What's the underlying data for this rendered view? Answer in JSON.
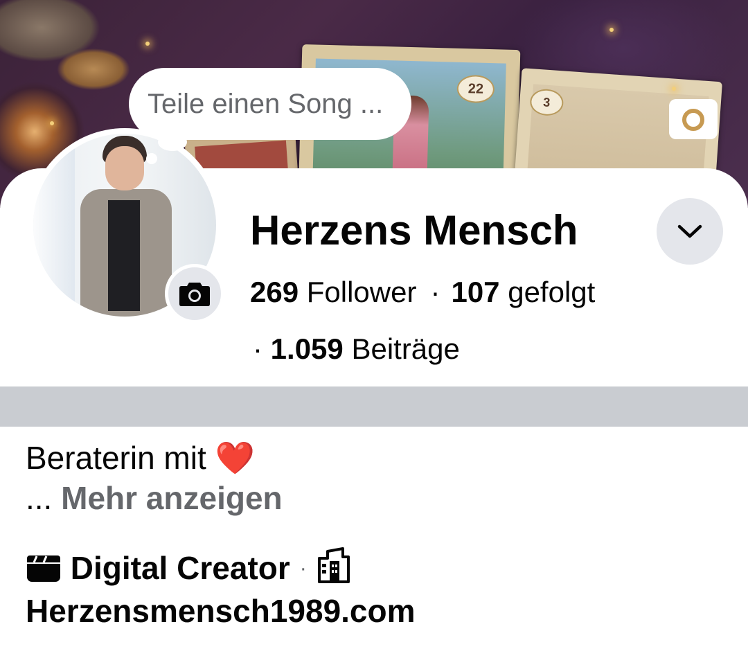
{
  "profile": {
    "song_prompt": "Teile einen Song ...",
    "name": "Herzens Mensch",
    "followers_count": "269",
    "followers_label": "Follower",
    "following_count": "107",
    "following_label": "gefolgt",
    "posts_count": "1.059",
    "posts_label": "Beiträge",
    "stats_separator": "·"
  },
  "cover": {
    "card_numbers": [
      "22",
      "3"
    ]
  },
  "bio": {
    "text": "Beraterin mit",
    "emoji": "❤️",
    "ellipsis": "...",
    "more_label": "Mehr anzeigen"
  },
  "details": {
    "category": "Digital Creator",
    "separator": "·",
    "website": "Herzensmensch1989.com"
  },
  "icons": {
    "cover_camera": "camera-icon",
    "avatar_camera": "camera-icon",
    "dropdown": "chevron-down-icon",
    "category": "clapperboard-icon",
    "website": "building-icon"
  },
  "colors": {
    "primary_text": "#050505",
    "secondary_text": "#65676b",
    "button_bg": "#e4e6eb",
    "divider": "#c9ccd1"
  }
}
